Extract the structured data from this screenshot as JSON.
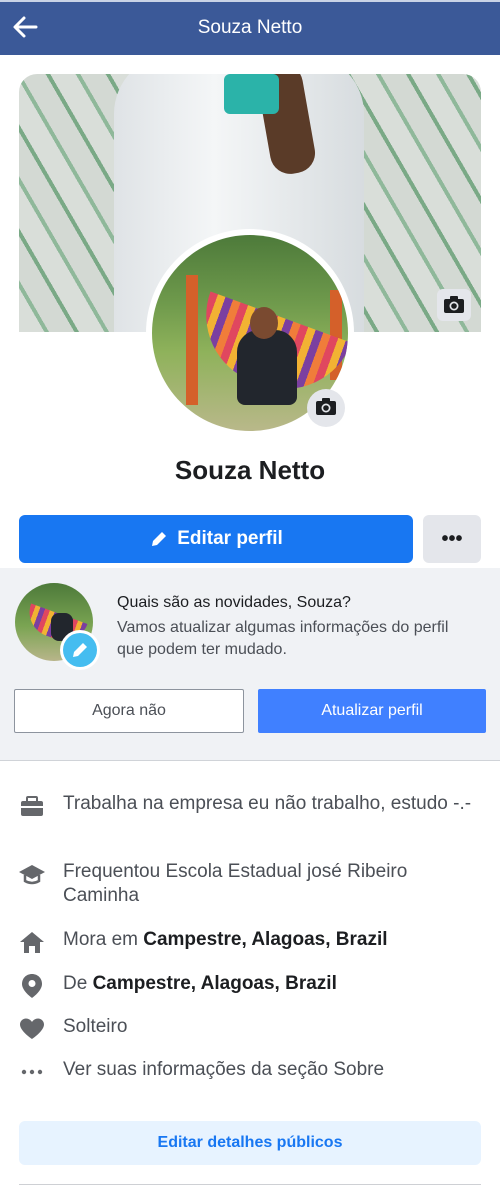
{
  "header": {
    "title": "Souza Netto"
  },
  "profile": {
    "name": "Souza Netto",
    "edit_profile_label": "Editar perfil",
    "more_label": "•••"
  },
  "prompt": {
    "title": "Quais são as novidades, Souza?",
    "description": "Vamos atualizar algumas informações do perfil que podem ter mudado.",
    "later_label": "Agora não",
    "update_label": "Atualizar perfil"
  },
  "about": {
    "work": "Trabalha na empresa eu não trabalho, estudo -.-",
    "education": "Frequentou Escola Estadual josé Ribeiro Caminha",
    "lives_prefix": "Mora em ",
    "lives_place": "Campestre, Alagoas, Brazil",
    "from_prefix": "De ",
    "from_place": "Campestre, Alagoas, Brazil",
    "relationship": "Solteiro",
    "see_about": "Ver suas informações da seção Sobre"
  },
  "edit_details_label": "Editar detalhes públicos",
  "colors": {
    "header": "#3b5998",
    "primary": "#1877f2",
    "secondary_button": "#4080ff",
    "light_blue": "#e7f3ff"
  },
  "icons": [
    "back-arrow-icon",
    "camera-icon",
    "pencil-icon",
    "briefcase-icon",
    "graduation-cap-icon",
    "home-icon",
    "location-pin-icon",
    "heart-icon",
    "more-dots-icon"
  ]
}
